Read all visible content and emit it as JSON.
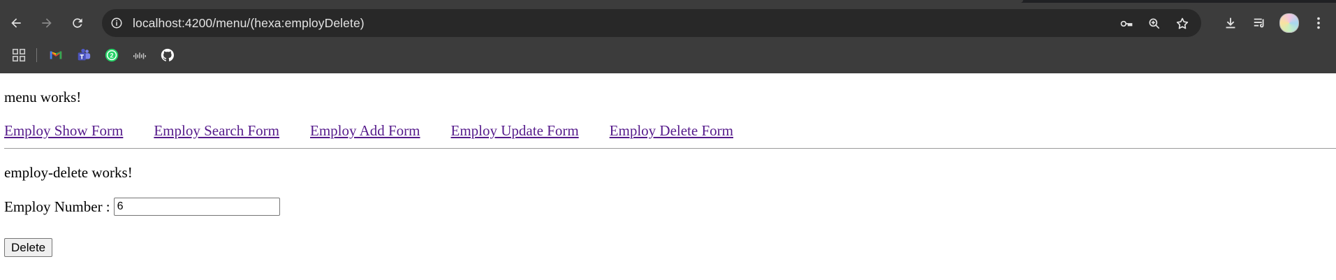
{
  "browser": {
    "url": "localhost:4200/menu/(hexa:employDelete)",
    "bookmarks": [
      {
        "icon": "apps-grid-icon"
      },
      {
        "icon": "gmail-icon"
      },
      {
        "icon": "teams-icon"
      },
      {
        "icon": "whatsapp-icon",
        "badge": "2"
      },
      {
        "icon": "cisco-icon"
      },
      {
        "icon": "github-icon"
      }
    ]
  },
  "page": {
    "menu_title": "menu works!",
    "nav_links": [
      "Employ Show Form",
      "Employ Search Form",
      "Employ Add Form",
      "Employ Update Form",
      "Employ Delete Form"
    ],
    "component_title": "employ-delete works!",
    "employ_number_label": "Employ Number :",
    "employ_number_value": "6",
    "delete_button": "Delete"
  },
  "colors": {
    "chrome_bg": "#3c3c3c",
    "omnibox_bg": "#282828",
    "visited_link": "#551a8b"
  }
}
